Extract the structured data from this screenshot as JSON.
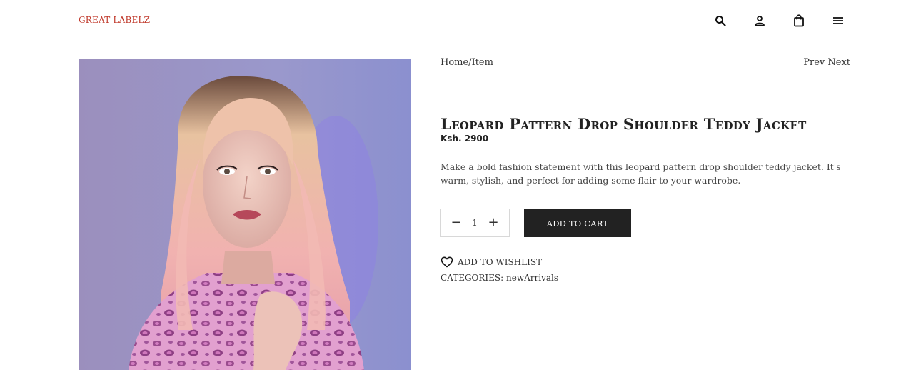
{
  "header": {
    "brand": "GREAT LABELZ",
    "icons": [
      "search-icon",
      "user-icon",
      "shopping-bag-icon",
      "menu-icon"
    ]
  },
  "breadcrumb": "Home/Item",
  "nav": {
    "prev": "Prev",
    "next": "Next"
  },
  "product": {
    "title": "Leopard Pattern Drop Shoulder Teddy Jacket",
    "price": "Ksh. 2900",
    "description": "Make a bold fashion statement with this leopard pattern drop shoulder teddy jacket. It's warm, stylish, and perfect for adding some flair to your wardrobe.",
    "quantity": "1",
    "add_to_cart": "ADD TO CART",
    "wishlist": "ADD TO WISHLIST",
    "categories_label": "CATEGORIES:",
    "categories_value": "newArrivals"
  },
  "colors": {
    "brand": "#c0392b",
    "button_bg": "#222222",
    "button_text": "#ffffff"
  }
}
